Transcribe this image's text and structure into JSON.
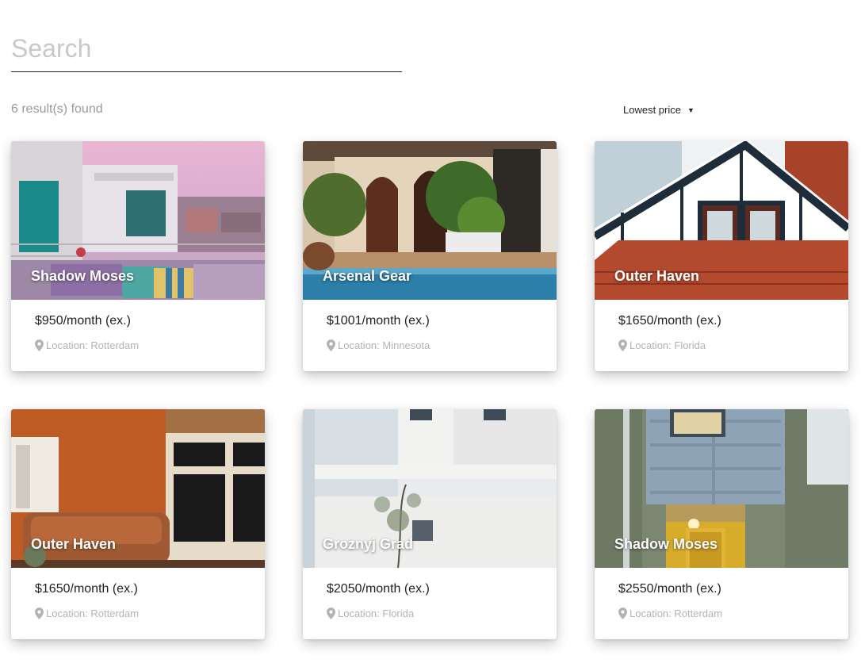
{
  "search": {
    "placeholder": "Search",
    "value": ""
  },
  "results": {
    "count_text": "6 result(s) found"
  },
  "sort": {
    "selected": "Lowest price",
    "caret_icon": "▼"
  },
  "listings": [
    {
      "title": "Shadow Moses",
      "price": "$950/month (ex.)",
      "location": "Location: Rotterdam",
      "icon": "map-pin-icon"
    },
    {
      "title": "Arsenal Gear",
      "price": "$1001/month (ex.)",
      "location": "Location: Minnesota",
      "icon": "map-pin-icon"
    },
    {
      "title": "Outer Haven",
      "price": "$1650/month (ex.)",
      "location": "Location: Florida",
      "icon": "map-pin-icon"
    },
    {
      "title": "Outer Haven",
      "price": "$1650/month (ex.)",
      "location": "Location: Rotterdam",
      "icon": "map-pin-icon"
    },
    {
      "title": "Groznyj Grad",
      "price": "$2050/month (ex.)",
      "location": "Location: Florida",
      "icon": "map-pin-icon"
    },
    {
      "title": "Shadow Moses",
      "price": "$2550/month (ex.)",
      "location": "Location: Rotterdam",
      "icon": "map-pin-icon"
    }
  ]
}
